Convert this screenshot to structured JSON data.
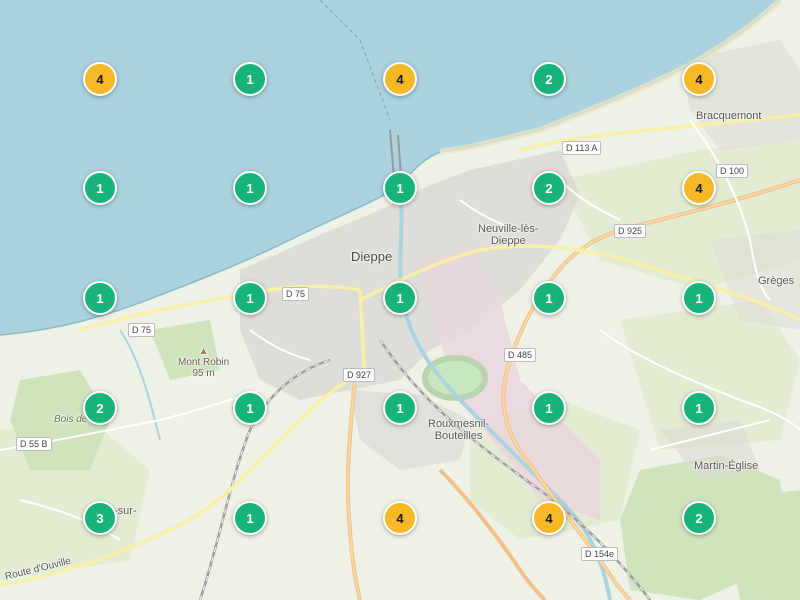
{
  "map": {
    "places": {
      "dieppe": "Dieppe",
      "neuville_line1": "Neuville-lès-",
      "neuville_line2": "Dieppe",
      "bracquemont": "Bracquemont",
      "greges": "Grèges",
      "rouxmesnil_line1": "Rouxmesnil-",
      "rouxmesnil_line2": "Bouteilles",
      "martin_eglise": "Martin-Église",
      "mont_robin_name": "Mont Robin",
      "mont_robin_elev": "95 m",
      "bois_de": "Bois de",
      "sur_fragment": "-sur-",
      "route_douville": "Route d'Ouville"
    },
    "roads": {
      "d113a": "D 113 A",
      "d100": "D 100",
      "d925": "D 925",
      "d75_a": "D 75",
      "d75_b": "D 75",
      "d485": "D 485",
      "d927": "D 927",
      "d55b": "D 55 B",
      "d154e": "D 154e"
    },
    "colors": {
      "sea": "#aad3df",
      "land": "#eef2e6",
      "cluster_small": "#16b47a",
      "cluster_large": "#f6b824"
    },
    "clusters": [
      [
        4,
        1,
        4,
        2,
        4
      ],
      [
        1,
        1,
        1,
        2,
        4
      ],
      [
        1,
        1,
        1,
        1,
        1
      ],
      [
        2,
        1,
        1,
        1,
        1
      ],
      [
        3,
        1,
        4,
        4,
        2
      ]
    ]
  }
}
